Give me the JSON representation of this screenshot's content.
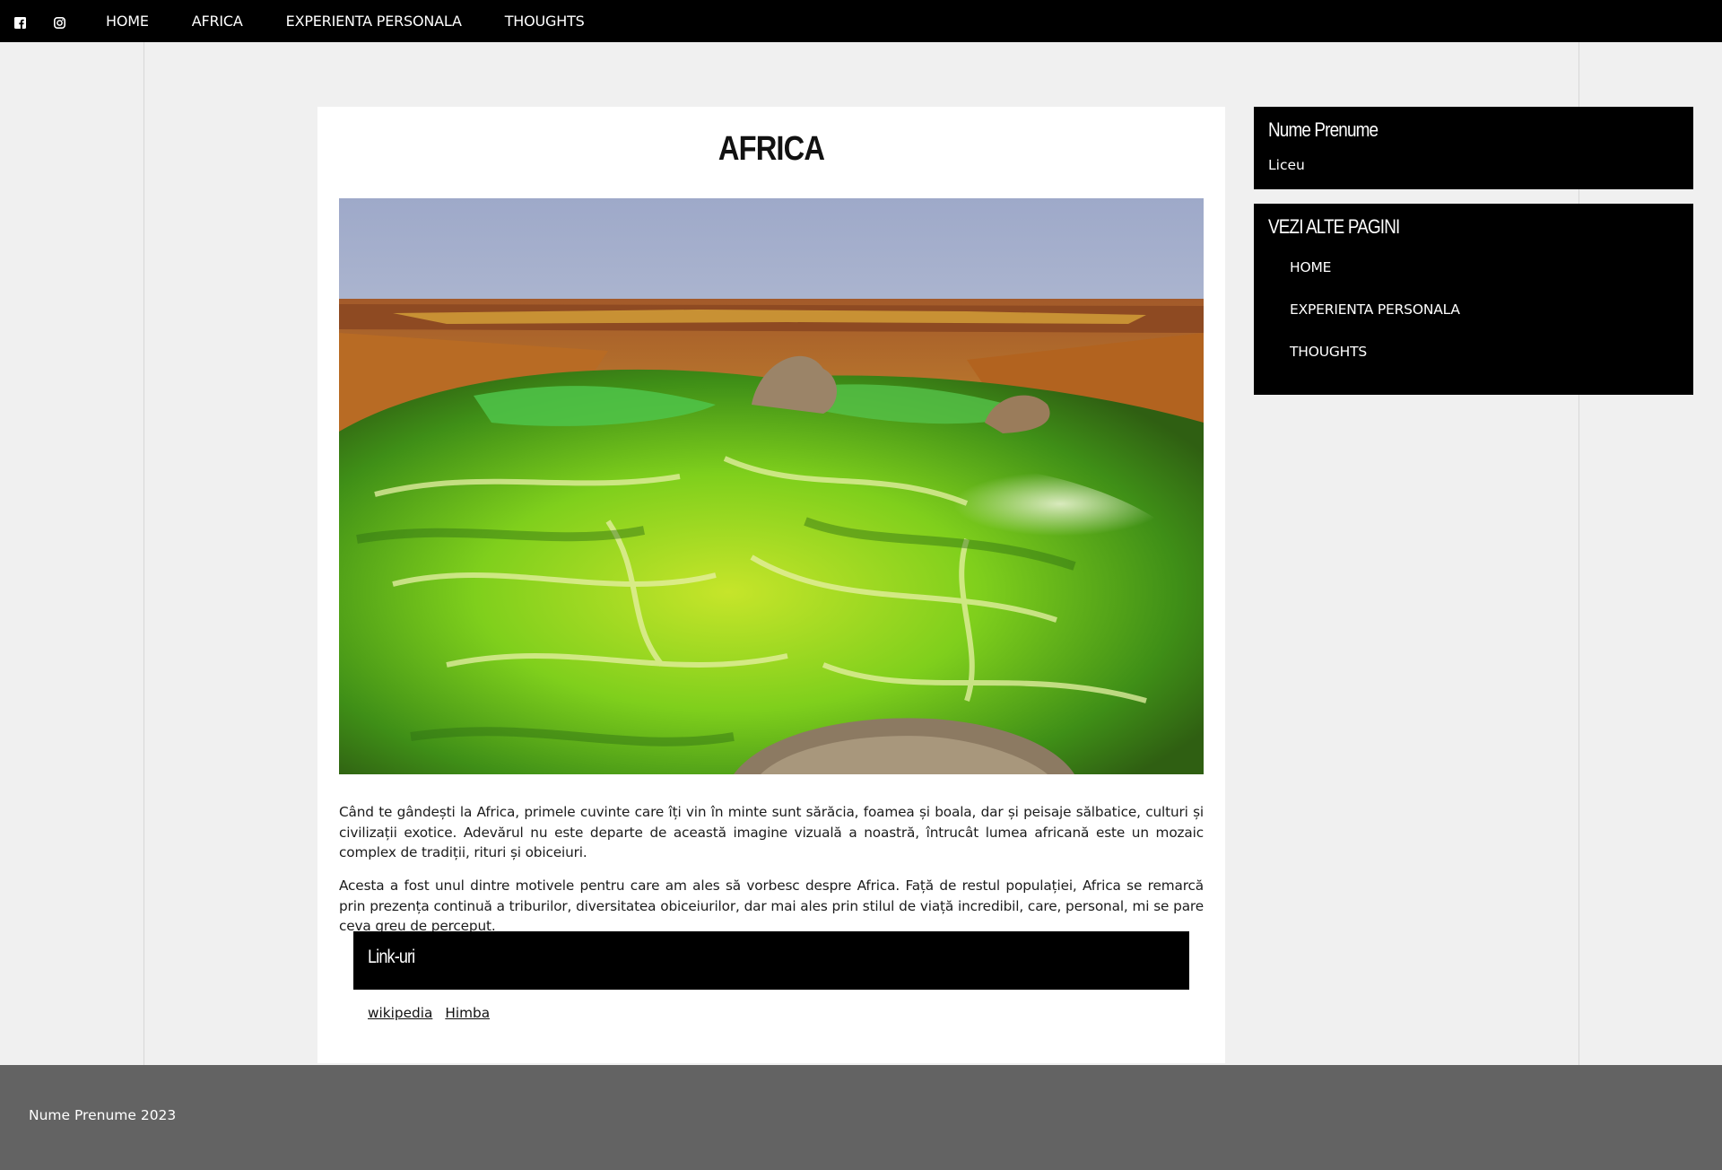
{
  "topbar": {
    "social": [
      {
        "icon": "facebook-icon"
      },
      {
        "icon": "instagram-icon"
      }
    ],
    "nav": [
      "HOME",
      "AFRICA",
      "EXPERIENTA PERSONALA",
      "THOUGHTS"
    ]
  },
  "article": {
    "title": "AFRICA",
    "paragraphs": [
      "Când te gândești la Africa, primele cuvinte care îți vin în minte sunt sărăcia, foamea și boala, dar și peisaje sălbatice, culturi și civilizații exotice. Adevărul nu este departe de această imagine vizuală a noastră, întrucât lumea africană este un mozaic complex de tradiții, rituri și obiceiuri.",
      "Acesta a fost unul dintre motivele pentru care am ales să vorbesc despre Africa. Față de restul populației, Africa se remarcă prin prezența continuă a triburilor, diversitatea obiceiurilor, dar mai ales prin stilul de viață incredibil, care, personal, mi se pare ceva greu de perceput."
    ],
    "links_title": "Link-uri",
    "links": [
      "wikipedia",
      "Himba"
    ]
  },
  "sidebar": {
    "profile": {
      "name": "Nume Prenume",
      "school": "Liceu"
    },
    "pages": {
      "title": "VEZI ALTE PAGINI",
      "items": [
        "HOME",
        "EXPERIENTA PERSONALA",
        "THOUGHTS"
      ]
    }
  },
  "footer": {
    "text": "Nume Prenume 2023"
  }
}
